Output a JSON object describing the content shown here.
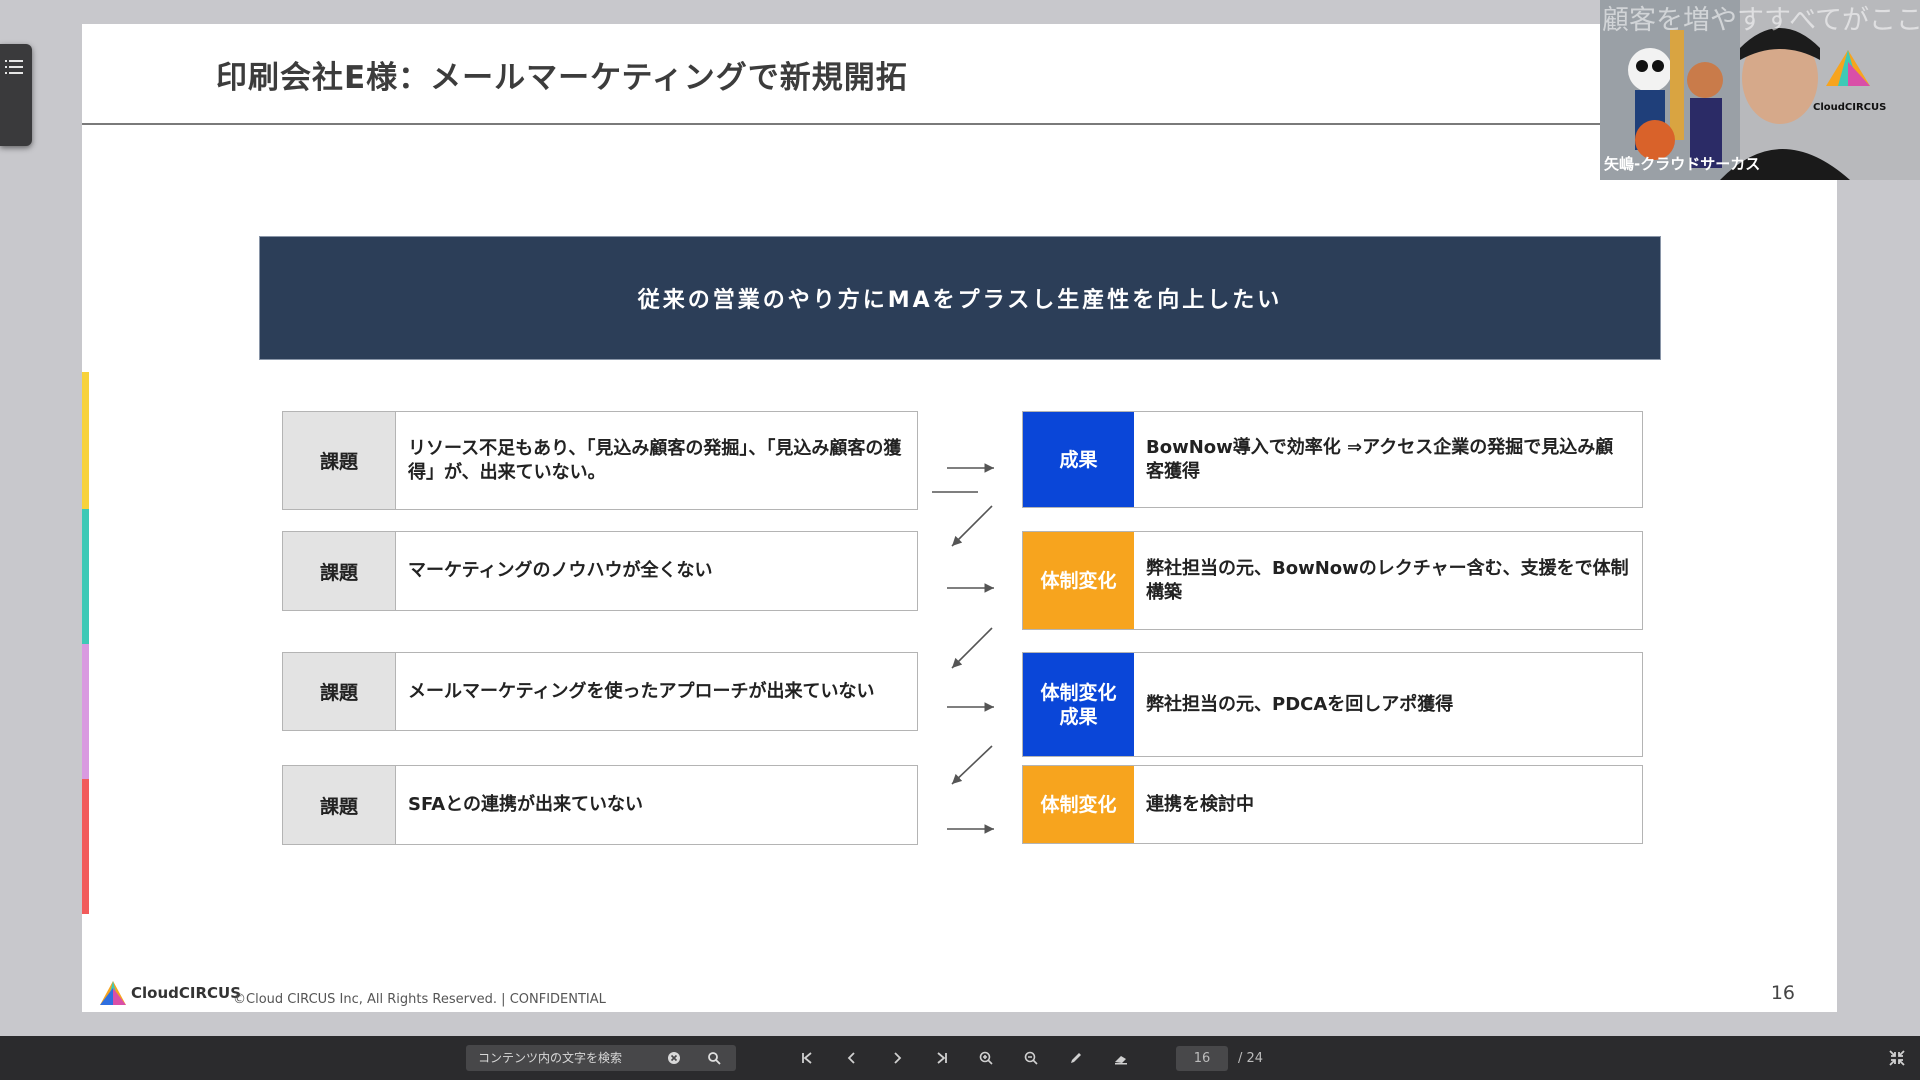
{
  "slide": {
    "title": "印刷会社E様：メールマーケティングで新規開拓",
    "banner": "従来の営業のやり方にMAをプラスし生産性を向上したい",
    "issues": [
      {
        "tag": "課題",
        "text": "リソース不足もあり、「見込み顧客の発掘」、「見込み顧客の獲得」が、出来ていない。"
      },
      {
        "tag": "課題",
        "text": "マーケティングのノウハウが全くない"
      },
      {
        "tag": "課題",
        "text": "メールマーケティングを使ったアプローチが出来ていない"
      },
      {
        "tag": "課題",
        "text": "SFAとの連携が出来ていない"
      }
    ],
    "results": [
      {
        "tag": "成果",
        "text": "BowNow導入で効率化 ⇒アクセス企業の発掘で見込み顧客獲得",
        "color": "#0a46d8"
      },
      {
        "tag": "体制変化",
        "text": "弊社担当の元、BowNowのレクチャー含む、支援をで体制構築",
        "color": "#f7a41e"
      },
      {
        "tag": "体制変化 成果",
        "text": "弊社担当の元、PDCAを回しアポ獲得",
        "color": "#0a46d8"
      },
      {
        "tag": "体制変化",
        "text": "連携を検討中",
        "color": "#f7a41e"
      }
    ],
    "strip_colors": [
      "#f7d23c",
      "#3ec9b6",
      "#d99ae0",
      "#f25b5b"
    ],
    "footer_brand": "CloudCIRCUS",
    "footer_copyright": "©Cloud CIRCUS Inc, All Rights Reserved. | CONFIDENTIAL",
    "page_number": "16"
  },
  "video": {
    "overlay_text": "顧客を増やすすべてがここに",
    "participant_name": "矢嶋-クラウドサーカス",
    "brand": "CloudCIRCUS"
  },
  "toolbar": {
    "search_placeholder": "コンテンツ内の文字を検索",
    "current_page": "16",
    "total_pages": "/ 24"
  }
}
